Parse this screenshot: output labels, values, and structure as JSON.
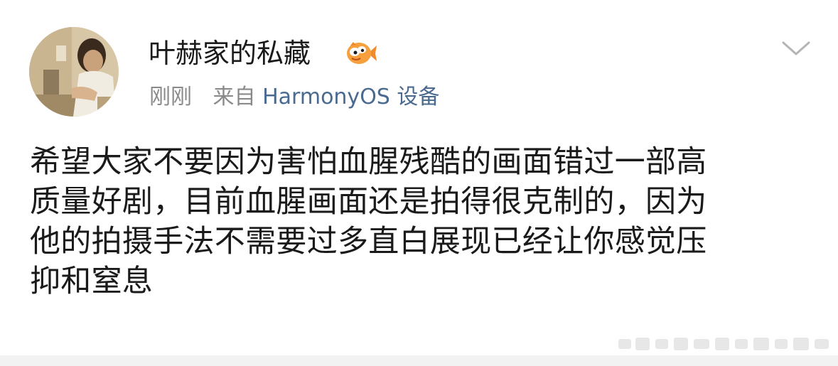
{
  "post": {
    "username": "叶赫家的私藏",
    "timestamp": "刚刚",
    "source_prefix": "来自",
    "source_device": "HarmonyOS 设备",
    "content": "希望大家不要因为害怕血腥残酷的画面错过一部高\n质量好剧，目前血腥画面还是拍得很克制的，因为\n他的拍摄手法不需要过多直白展现已经让你感觉压\n抑和窒息",
    "avatar_icon": "avatar-photo",
    "badge_icon": "fish-emoji-badge-icon",
    "menu_icon": "chevron-down-icon"
  },
  "colors": {
    "text_primary": "#1a1a1a",
    "text_meta": "#8a8a8a",
    "link": "#4a6a90",
    "badge_orange": "#f08a2c",
    "bottom_bar": "#f2f2f2"
  }
}
